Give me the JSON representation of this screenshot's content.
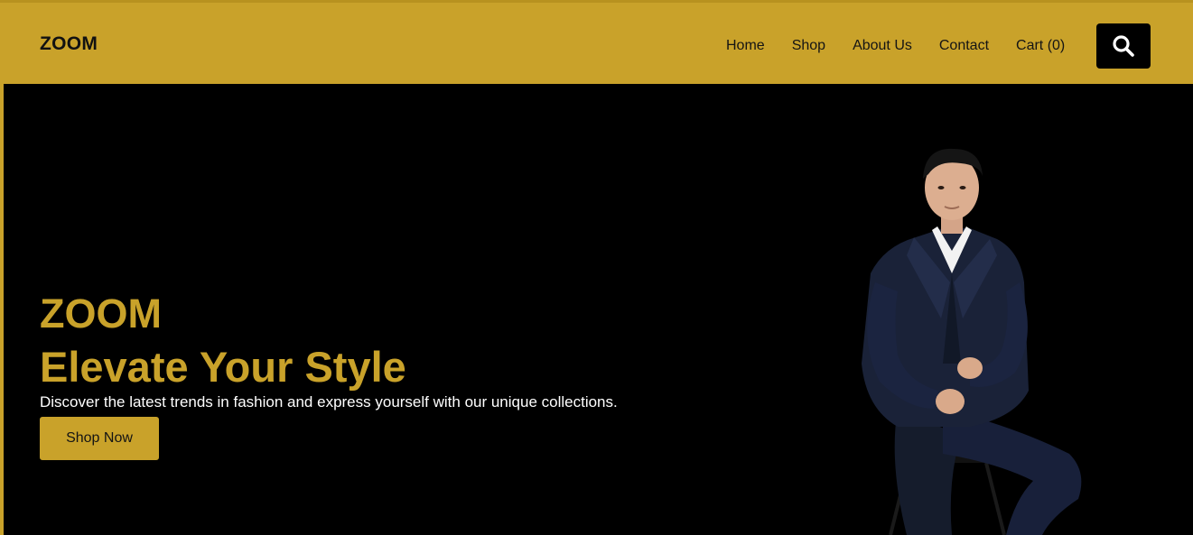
{
  "header": {
    "logo": "ZOOM",
    "nav": [
      "Home",
      "Shop",
      "About Us",
      "Contact",
      "Cart (0)"
    ],
    "search_icon": "search-icon"
  },
  "hero": {
    "brand": "ZOOM",
    "title": "Elevate Your Style",
    "subtitle": "Discover the latest trends in fashion and express yourself with our unique collections.",
    "cta_label": "Shop Now",
    "image": "man-in-suit-sitting-photo"
  },
  "colors": {
    "accent": "#c9a22a",
    "hero_bg": "#000000",
    "text_dark": "#141414"
  }
}
